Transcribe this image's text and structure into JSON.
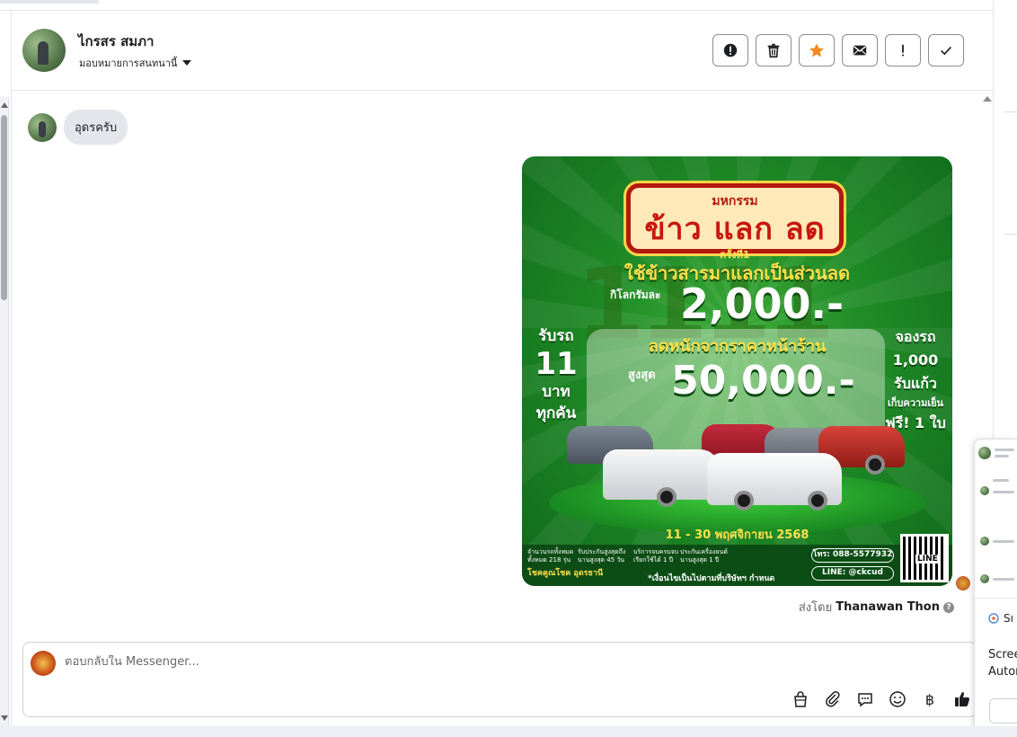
{
  "header": {
    "contact_name": "ไกรสร สมภา",
    "assign_label": "มอบหมายการสนทนานี้"
  },
  "toolbar": {
    "buttons": [
      {
        "name": "report-spam",
        "icon": "alert-circle-icon"
      },
      {
        "name": "delete",
        "icon": "trash-icon"
      },
      {
        "name": "star",
        "icon": "star-icon",
        "color": "#f5891f"
      },
      {
        "name": "mark-unread",
        "icon": "envelope-icon"
      },
      {
        "name": "follow-up",
        "icon": "exclamation-icon"
      },
      {
        "name": "mark-done",
        "icon": "check-icon"
      }
    ]
  },
  "messages": {
    "incoming_text": "อุดรครับ",
    "sent_by_prefix": "ส่งโดย",
    "sent_by_name": "Thanawan Thon"
  },
  "poster": {
    "event_small": "มหกรรม",
    "event_title": "ข้าว แลก ลด",
    "times_label": "ครั้งที่1",
    "line1": "ใช้ข้าวสารมาแลกเป็นส่วนลด",
    "kg_label": "กิโลกรัมละ",
    "amount1": "2,000.-",
    "line2": "ลดหนักจากราคาหน้าร้าน",
    "max_label": "สูงสุด",
    "amount2": "50,000.-",
    "left_col": [
      "รับรถ",
      "11",
      "บาท",
      "ทุกคัน"
    ],
    "right_col": [
      "จองรถ",
      "1,000",
      "รับแก้ว",
      "เก็บความเย็น",
      "ฟรี! 1 ใบ"
    ],
    "date": "11 - 30 พฤศจิกายน 2568",
    "stats": [
      {
        "label": "จำนวนรถทั้งหมด",
        "value": "ทั้งหมด 218 รุ่น"
      },
      {
        "label": "รับประกันสูงสุดถึง",
        "value": "นานสูงสุด 45 วัน"
      },
      {
        "label": "บริการจบครบจบ",
        "value": "เรียกใช้ได้ 1 ปี"
      },
      {
        "label": "ประกันเครื่องยนต์",
        "value": "นานสูงสุด 1 ปี"
      }
    ],
    "brand": "โชคคูณโชค อุดรธานี",
    "note": "*เงื่อนไขเป็นไปตามที่บริษัทฯ กำหนด",
    "phone": "โทร: 088-5577932",
    "line_id": "LINE: @ckcud",
    "qr_label": "LINE",
    "colors": {
      "green": "#1f8a26",
      "yellow": "#ffe14a",
      "red": "#c8170e"
    }
  },
  "composer": {
    "placeholder": "ตอบกลับใน Messenger...",
    "icons": [
      "shopping-bag-icon",
      "paperclip-icon",
      "saved-reply-icon",
      "emoji-icon",
      "baht-icon",
      "thumbs-up-icon"
    ]
  },
  "side_panel": {
    "app_label": "Sı",
    "text1": "Scree",
    "text2": "Autor"
  }
}
